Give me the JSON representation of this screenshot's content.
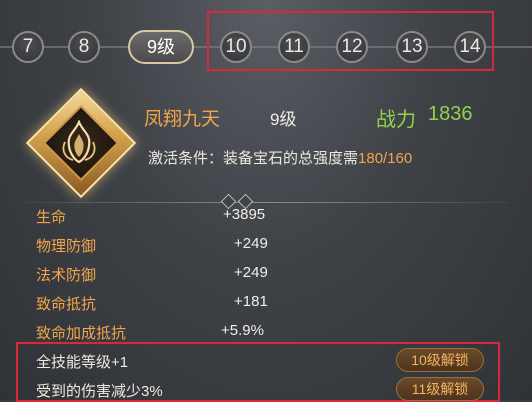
{
  "levels": {
    "items": [
      "7",
      "8",
      "9级",
      "10",
      "11",
      "12",
      "13",
      "14"
    ],
    "selected": "9级"
  },
  "skill": {
    "icon": "flame-emblem-icon",
    "name": "凤翔九天",
    "level": "9级",
    "power_label": "战力",
    "power_value": "1836",
    "condition_prefix": "激活条件：装备宝石的总强度需",
    "condition_progress": "180/160"
  },
  "stats": [
    {
      "label": "生命",
      "value": "+3895"
    },
    {
      "label": "物理防御",
      "value": "+249"
    },
    {
      "label": "法术防御",
      "value": "+249"
    },
    {
      "label": "致命抵抗",
      "value": "+181"
    },
    {
      "label": "致命加成抵抗",
      "value": "+5.9%"
    }
  ],
  "locked_bonuses": [
    {
      "text": "全技能等级+1",
      "unlock": "10级解锁"
    },
    {
      "text": "受到的伤害减少3%",
      "unlock": "11级解锁"
    }
  ],
  "colors": {
    "highlight_red": "#d8283a",
    "gold": "#f2a64a",
    "green": "#8fd449"
  }
}
